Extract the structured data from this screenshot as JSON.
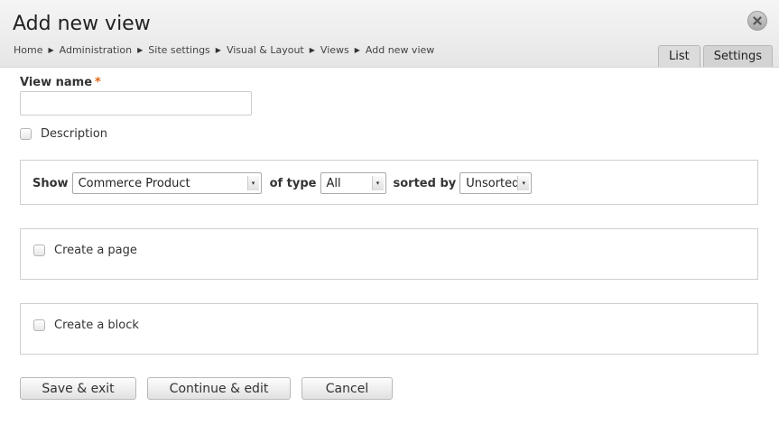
{
  "header": {
    "title": "Add new view",
    "breadcrumb": [
      "Home",
      "Administration",
      "Site settings",
      "Visual & Layout",
      "Views",
      "Add new view"
    ],
    "tabs": [
      "List",
      "Settings"
    ]
  },
  "form": {
    "view_name_label": "View name",
    "required_marker": "*",
    "view_name_value": "",
    "description_label": "Description",
    "show": {
      "show_label": "Show",
      "show_value": "Commerce Product",
      "type_label": "of type",
      "type_value": "All",
      "sorted_label": "sorted by",
      "sorted_value": "Unsorted"
    },
    "page_label": "Create a page",
    "block_label": "Create a block"
  },
  "buttons": {
    "save": "Save & exit",
    "continue": "Continue & edit",
    "cancel": "Cancel"
  },
  "colors": {
    "required": "#e0661a",
    "header_bg": "#eeeeee"
  }
}
